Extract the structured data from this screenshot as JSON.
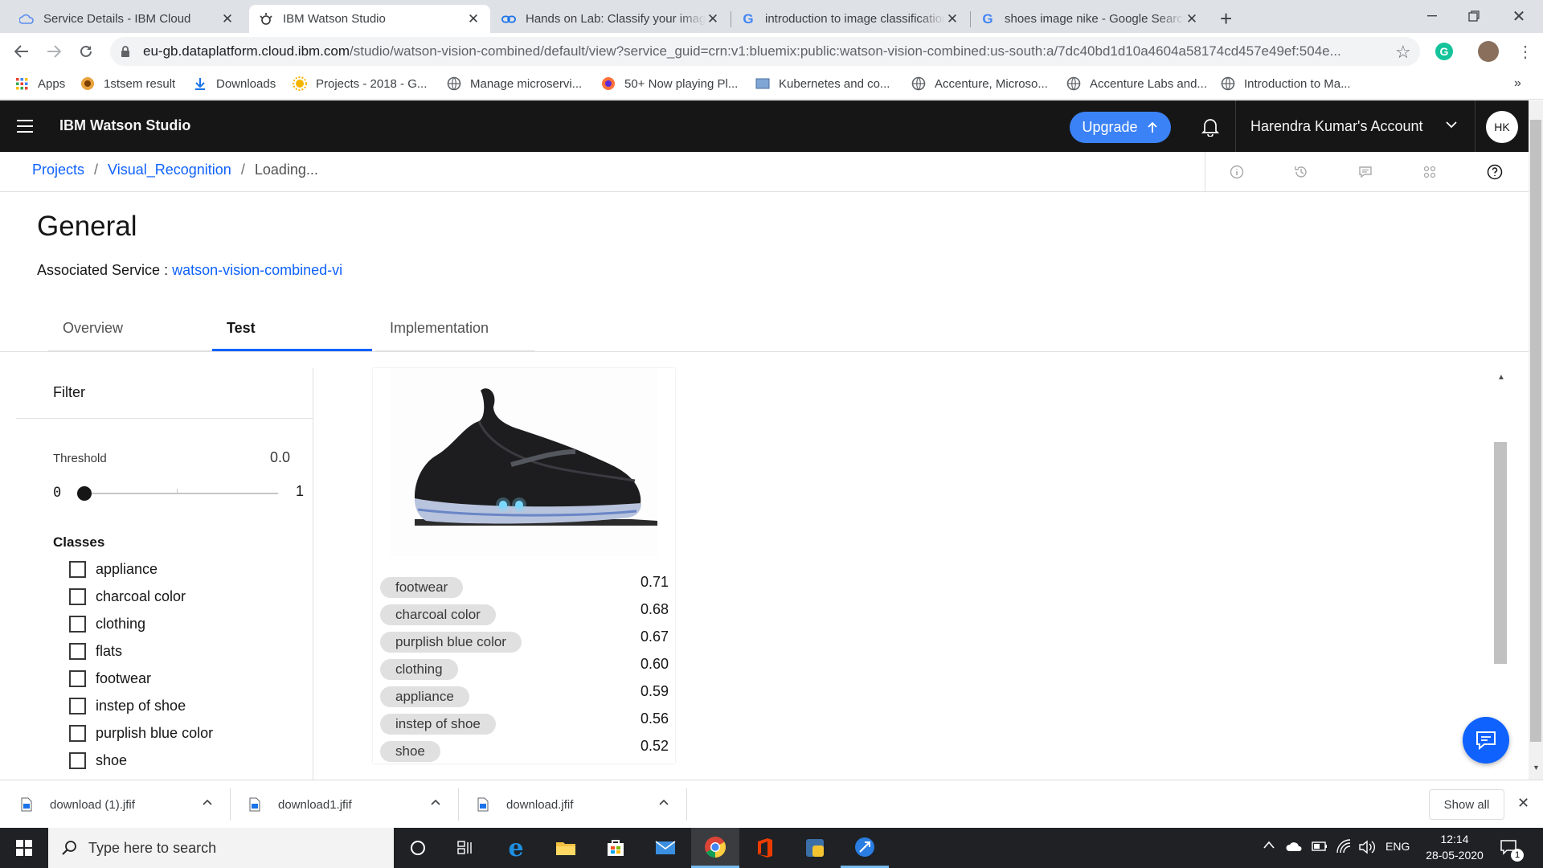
{
  "browser": {
    "tabs": [
      {
        "title": "Service Details - IBM Cloud",
        "icon": "ibm-cloud-icon",
        "active": false
      },
      {
        "title": "IBM Watson Studio",
        "icon": "watson-icon",
        "active": true
      },
      {
        "title": "Hands on Lab: Classify your image",
        "icon": "link-icon",
        "active": false
      },
      {
        "title": "introduction to image classification",
        "icon": "google-icon",
        "active": false
      },
      {
        "title": "shoes image nike - Google Search",
        "icon": "google-icon",
        "active": false
      }
    ],
    "url_host": "eu-gb.dataplatform.cloud.ibm.com",
    "url_path": "/studio/watson-vision-combined/default/view?service_guid=crn:v1:bluemix:public:watson-vision-combined:us-south:a/7dc40bd1d10a4604a58174cd457e49ef:504e...",
    "bookmarks": [
      {
        "label": "Apps",
        "icon": "apps-grid-icon"
      },
      {
        "label": "1stsem result",
        "icon": "site-icon"
      },
      {
        "label": "Downloads",
        "icon": "download-icon"
      },
      {
        "label": "Projects - 2018 - G...",
        "icon": "sun-icon"
      },
      {
        "label": "Manage microservi...",
        "icon": "globe-icon"
      },
      {
        "label": "50+ Now playing Pl...",
        "icon": "firefox-icon"
      },
      {
        "label": "Kubernetes and co...",
        "icon": "image-icon"
      },
      {
        "label": "Accenture, Microso...",
        "icon": "globe-icon"
      },
      {
        "label": "Accenture Labs and...",
        "icon": "globe-icon"
      },
      {
        "label": "Introduction to Ma...",
        "icon": "globe-icon"
      }
    ],
    "more": "»"
  },
  "app": {
    "name": "IBM Watson Studio",
    "upgrade_label": "Upgrade",
    "account": "Harendra Kumar's Account",
    "avatar": "HK"
  },
  "breadcrumb": {
    "items": [
      "Projects",
      "Visual_Recognition"
    ],
    "current": "Loading...",
    "sep": "/"
  },
  "page": {
    "title": "General",
    "assoc_label": "Associated Service :",
    "assoc_link": "watson-vision-combined-vi",
    "tabs": [
      "Overview",
      "Test",
      "Implementation"
    ],
    "selected_tab": "Test"
  },
  "filter": {
    "title": "Filter",
    "threshold_label": "Threshold",
    "threshold_value": "0.0",
    "slider_min": "0",
    "slider_max": "1",
    "slider_level": 0.0,
    "classes_title": "Classes",
    "classes": [
      "appliance",
      "charcoal color",
      "clothing",
      "flats",
      "footwear",
      "instep of shoe",
      "purplish blue color",
      "shoe"
    ]
  },
  "results": [
    {
      "label": "footwear",
      "score": "0.71"
    },
    {
      "label": "charcoal color",
      "score": "0.68"
    },
    {
      "label": "purplish blue color",
      "score": "0.67"
    },
    {
      "label": "clothing",
      "score": "0.60"
    },
    {
      "label": "appliance",
      "score": "0.59"
    },
    {
      "label": "instep of shoe",
      "score": "0.56"
    },
    {
      "label": "shoe",
      "score": "0.52"
    }
  ],
  "downloads": {
    "items": [
      "download (1).jfif",
      "download1.jfif",
      "download.jfif"
    ],
    "show_all": "Show all"
  },
  "taskbar": {
    "search_placeholder": "Type here to search",
    "lang": "ENG",
    "time": "12:14",
    "date": "28-05-2020",
    "notif_count": "1"
  },
  "colors": {
    "accent": "#0f62fe",
    "upgrade": "#3b82f6",
    "header_bg": "#161616",
    "chat_fab": "#0f62fe"
  }
}
